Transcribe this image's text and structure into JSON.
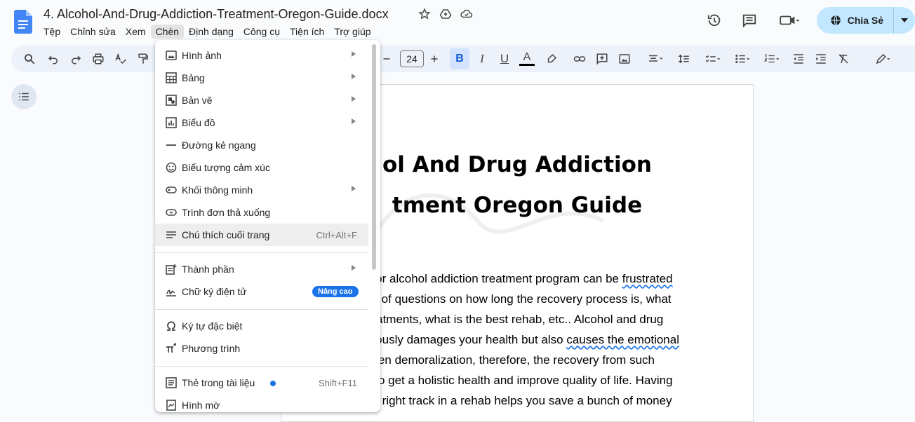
{
  "app": {
    "title": "4. Alcohol-And-Drug-Addiction-Treatment-Oregon-Guide.docx"
  },
  "menubar": [
    "Tệp",
    "Chỉnh sửa",
    "Xem",
    "Chèn",
    "Định dạng",
    "Công cụ",
    "Tiện ích",
    "Trợ giúp"
  ],
  "share": {
    "label": "Chia Sẻ"
  },
  "toolbar": {
    "font_size": "24",
    "bold": "B",
    "italic": "I",
    "underline": "U",
    "text_color": "A"
  },
  "insert_menu": {
    "items": [
      {
        "label": "Hình ảnh",
        "icon": "image-icon",
        "submenu": true
      },
      {
        "label": "Bảng",
        "icon": "table-icon",
        "submenu": true
      },
      {
        "label": "Bản vẽ",
        "icon": "drawing-icon",
        "submenu": true
      },
      {
        "label": "Biểu đồ",
        "icon": "chart-icon",
        "submenu": true
      },
      {
        "label": "Đường kẻ ngang",
        "icon": "horizontal-line-icon",
        "submenu": false
      },
      {
        "label": "Biểu tượng cảm xúc",
        "icon": "emoji-icon",
        "submenu": false
      },
      {
        "label": "Khối thông minh",
        "icon": "smart-chip-icon",
        "submenu": true
      },
      {
        "label": "Trình đơn thả xuống",
        "icon": "dropdown-icon",
        "submenu": false
      },
      {
        "label": "Chú thích cuối trang",
        "icon": "footnote-icon",
        "shortcut": "Ctrl+Alt+F"
      },
      {
        "label": "Thành phần",
        "icon": "building-blocks-icon",
        "submenu": true
      },
      {
        "label": "Chữ ký điện tử",
        "icon": "esignature-icon",
        "badge": "Nâng cao"
      },
      {
        "label": "Ký tự đặc biệt",
        "icon": "omega-icon"
      },
      {
        "label": "Phương trình",
        "icon": "pi-icon"
      },
      {
        "label": "Thẻ trong tài liệu",
        "icon": "tabs-icon",
        "shortcut": "Shift+F11"
      },
      {
        "label": "Hình mờ",
        "icon": "watermark-icon"
      }
    ]
  },
  "document": {
    "title_line1": "ol And Drug Addiction",
    "title_line2": "tment Oregon Guide",
    "lines": [
      [
        "g or alcohol addiction treatment program can be ",
        "frustrated"
      ],
      [
        "lot of questions on how long the recovery process is, what",
        ""
      ],
      [
        "reatments, what is the best rehab, etc.. Alcohol and drug",
        ""
      ],
      [
        "mously damages your health but also ",
        "causes the emotional"
      ],
      [
        "even demoralization, therefore, the recovery from such",
        ""
      ],
      [
        "y to get a holistic health and improve quality of life. Having",
        ""
      ],
      [
        "he right track in a rehab helps you save a bunch of money",
        ""
      ]
    ]
  }
}
